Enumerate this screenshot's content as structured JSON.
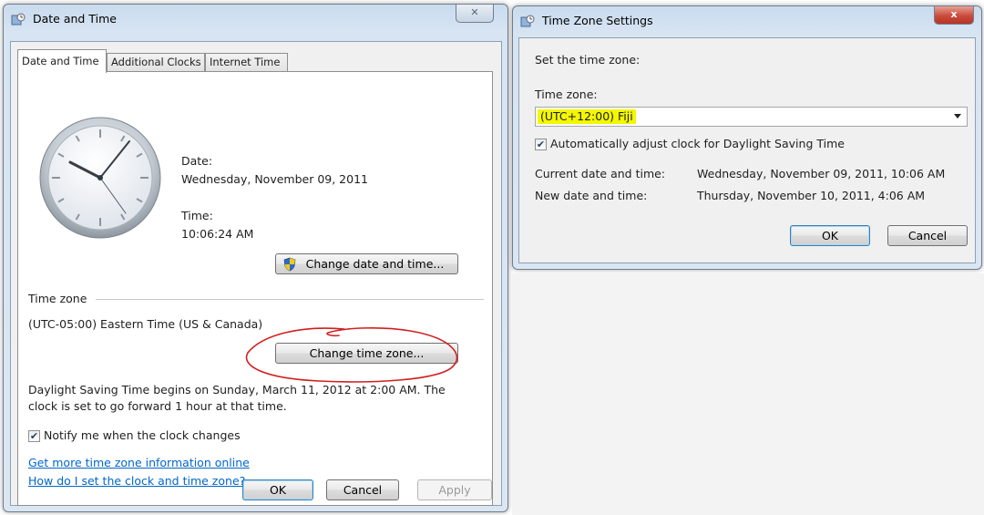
{
  "dt_window": {
    "title": "Date and Time",
    "close_label": "✕",
    "tabs": [
      {
        "label": "Date and Time"
      },
      {
        "label": "Additional Clocks"
      },
      {
        "label": "Internet Time"
      }
    ],
    "date_label": "Date:",
    "date_value": "Wednesday, November 09, 2011",
    "time_label": "Time:",
    "time_value": "10:06:24 AM",
    "change_date_time_label": "Change date and time...",
    "timezone_heading": "Time zone",
    "timezone_value": "(UTC-05:00) Eastern Time (US & Canada)",
    "change_timezone_label": "Change time zone...",
    "dst_line1": "Daylight Saving Time begins on Sunday, March 11, 2012 at 2:00 AM. The",
    "dst_line2": "clock is set to go forward 1 hour at that time.",
    "notify_label": "Notify me when the clock changes",
    "notify_checked": true,
    "link_more_info": "Get more time zone information online",
    "link_how_set": "How do I set the clock and time zone?",
    "ok_label": "OK",
    "cancel_label": "Cancel",
    "apply_label": "Apply"
  },
  "tz_window": {
    "title": "Time Zone Settings",
    "close_label": "x",
    "set_label": "Set the time zone:",
    "tz_field_label": "Time zone:",
    "tz_selected": "(UTC+12:00) Fiji",
    "auto_dst_label": "Automatically adjust clock for Daylight Saving Time",
    "auto_dst_checked": true,
    "current_label": "Current date and time:",
    "current_value": "Wednesday, November 09, 2011, 10:06 AM",
    "new_label": "New date and time:",
    "new_value": "Thursday, November 10, 2011, 4:06 AM",
    "ok_label": "OK",
    "cancel_label": "Cancel"
  },
  "colors": {
    "highlight": "#f3f700",
    "annotation_circle": "#d21f1f",
    "link": "#0066cc",
    "close_button_red": "#c94a3c"
  },
  "icons": [
    "clock-settings-icon",
    "analog-clock-icon",
    "uac-shield-icon",
    "dropdown-arrow-icon",
    "checkbox-check-icon"
  ]
}
